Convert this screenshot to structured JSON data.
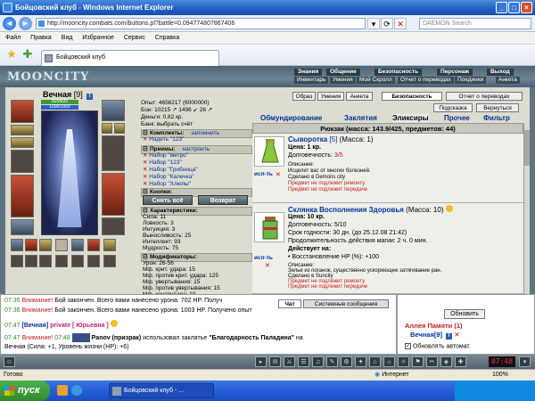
{
  "window": {
    "title": "Бойцовский клуб - Windows Internet Explorer",
    "address": "http://mooncity.combats.com/buttons.pl?battle=0.094774807867406",
    "search_placeholder": "DAEMON Search"
  },
  "menu": [
    "Файл",
    "Правка",
    "Вид",
    "Избранное",
    "Сервис",
    "Справка"
  ],
  "tab_label": "Бойцовский клуб",
  "game": {
    "logo": "MOONCITY",
    "top_nav": [
      "Знания",
      "Общение",
      "Безопасность",
      "Персонаж",
      "Выход"
    ],
    "sub_nav": [
      "Инвентарь",
      "Умения",
      "Мой Скролл",
      "Отчет о переводах",
      "Поединки",
      "Анкета"
    ],
    "character": {
      "name": "Вечная",
      "level": "[9]",
      "hp": "825/825",
      "mana": "1000/1000"
    },
    "stats": [
      "Опыт: 4656217 (6000000)",
      "Бои: 10215 ↗ 1496 ↙ 26 ↗",
      "Деньги: 0.82 кр.",
      "Банк: выбрать счёт"
    ],
    "sets": {
      "header": "Комплекты:",
      "save": "запомнить",
      "items": [
        "Надеть \"123\""
      ]
    },
    "tricks": {
      "header": "Приемы:",
      "configure": "настроить",
      "items": [
        "Набор \"метро\"",
        "Набор \"123\"",
        "Набор \"Грибница\"",
        "Набор \"Калечка\"",
        "Набор \"Хлюпы\""
      ]
    },
    "buttons_header": "Кнопки:",
    "remove_all": "Снять всё",
    "return_btn": "Возврат",
    "characteristics": {
      "header": "Характеристики:",
      "items": [
        "Сила: 11",
        "Ловкость: 3",
        "Интуиция: 3",
        "Выносливость: 25",
        "Интеллект: 93",
        "Мудрость: 75"
      ]
    },
    "modifiers": {
      "header": "Модификаторы:",
      "items": [
        "Урон: 26-56",
        "Мф. крит. удара: 15",
        "Мф. против крит. удара: 125",
        "Мф. увертывания: 15",
        "Мф. против увертывания: 15",
        "Мф. контрудара: 10"
      ]
    },
    "right_tabs": [
      "Образ",
      "Умения",
      "Анкета",
      "Безопасность",
      "Отчет о переводах"
    ],
    "hint": "Подсказка",
    "back": "Вернуться",
    "categories": [
      "Обмундирование",
      "Заклятия",
      "Эликсиры",
      "Прочее",
      "Фильтр"
    ],
    "backpack": "Рюкзак (масса: 143.9/425, предметов: 44)",
    "items": [
      {
        "name": "Сыворотка",
        "count": "[5]",
        "mass": "(Масса: 1)",
        "price": "Цена: 1 кр.",
        "durability_label": "Долговечность:",
        "durability": "3/5",
        "desc_label": "Описание:",
        "desc": "Исцелит вас от многих болезней.",
        "made": "Сделано в Demons city",
        "repair": "Предмет не подлежит ремонту",
        "transfer": "Предмет не подлежит передаче",
        "use": "исп-ть"
      },
      {
        "name": "Склянка Восполнения Здоровья",
        "mass": "(Масса: 10)",
        "price": "Цена: 10 кр.",
        "durability": "Долговечность: 5/10",
        "expiry": "Срок годности: 30 дн. (до 25.12.08 21:42)",
        "duration": "Продолжительность действия магии: 2 ч. 0 мин.",
        "effect_label": "Действует на:",
        "effect": "• Восстановление HP (%): +100",
        "desc_label": "Описание:",
        "desc": "Зелье из поганок, существенно ускоряющее затягивание ран.",
        "made": "Сделано в Suncity",
        "repair": "Предмет не подлежит ремонту",
        "transfer": "Предмет не подлежит передаче",
        "use": "исп-ть"
      }
    ]
  },
  "chat": {
    "tabs": [
      "Чат",
      "Системные сообщения"
    ],
    "lines": [
      {
        "time": "07:35",
        "warn": "Внимание!",
        "text": " Бой закончен. Всего вами нанесено урона: 702 HP. Получ"
      },
      {
        "time": "07:36",
        "warn": "Внимание!",
        "text": " Бой закончен. Всего вами нанесено урона: 1003 HP. Получено опыт"
      },
      {
        "time": "07:47",
        "from": "[Вечная]",
        "to": "private [ Юрьевна ]",
        "text": ""
      },
      {
        "time": "07:47",
        "warn": "Внимание!",
        "time2": "07:48",
        "who": "Panov (призрак)",
        "text": " использовал заклятье ",
        "spell": "\"Благодарность Паладина\"",
        "tail": " на"
      },
      {
        "text": "Вечная (Сила: +1, Уровень жизни (HP): +6)"
      }
    ]
  },
  "side": {
    "refresh": "Обновить",
    "alley": "Аллея Памяти (1)",
    "user": "Вечная[9]",
    "auto": "Обновлять автомат."
  },
  "toolbar_time": "07:48",
  "statusbar": {
    "left": "Готово",
    "zone": "Интернет",
    "zoom": "100%"
  },
  "taskbar": {
    "start": "пуск",
    "task": "Бойцовский клуб - ..."
  },
  "colors": {
    "accent": "#003399",
    "warning": "#c02020",
    "hp": "#3c9a3c",
    "mana": "#2d5fc8"
  }
}
